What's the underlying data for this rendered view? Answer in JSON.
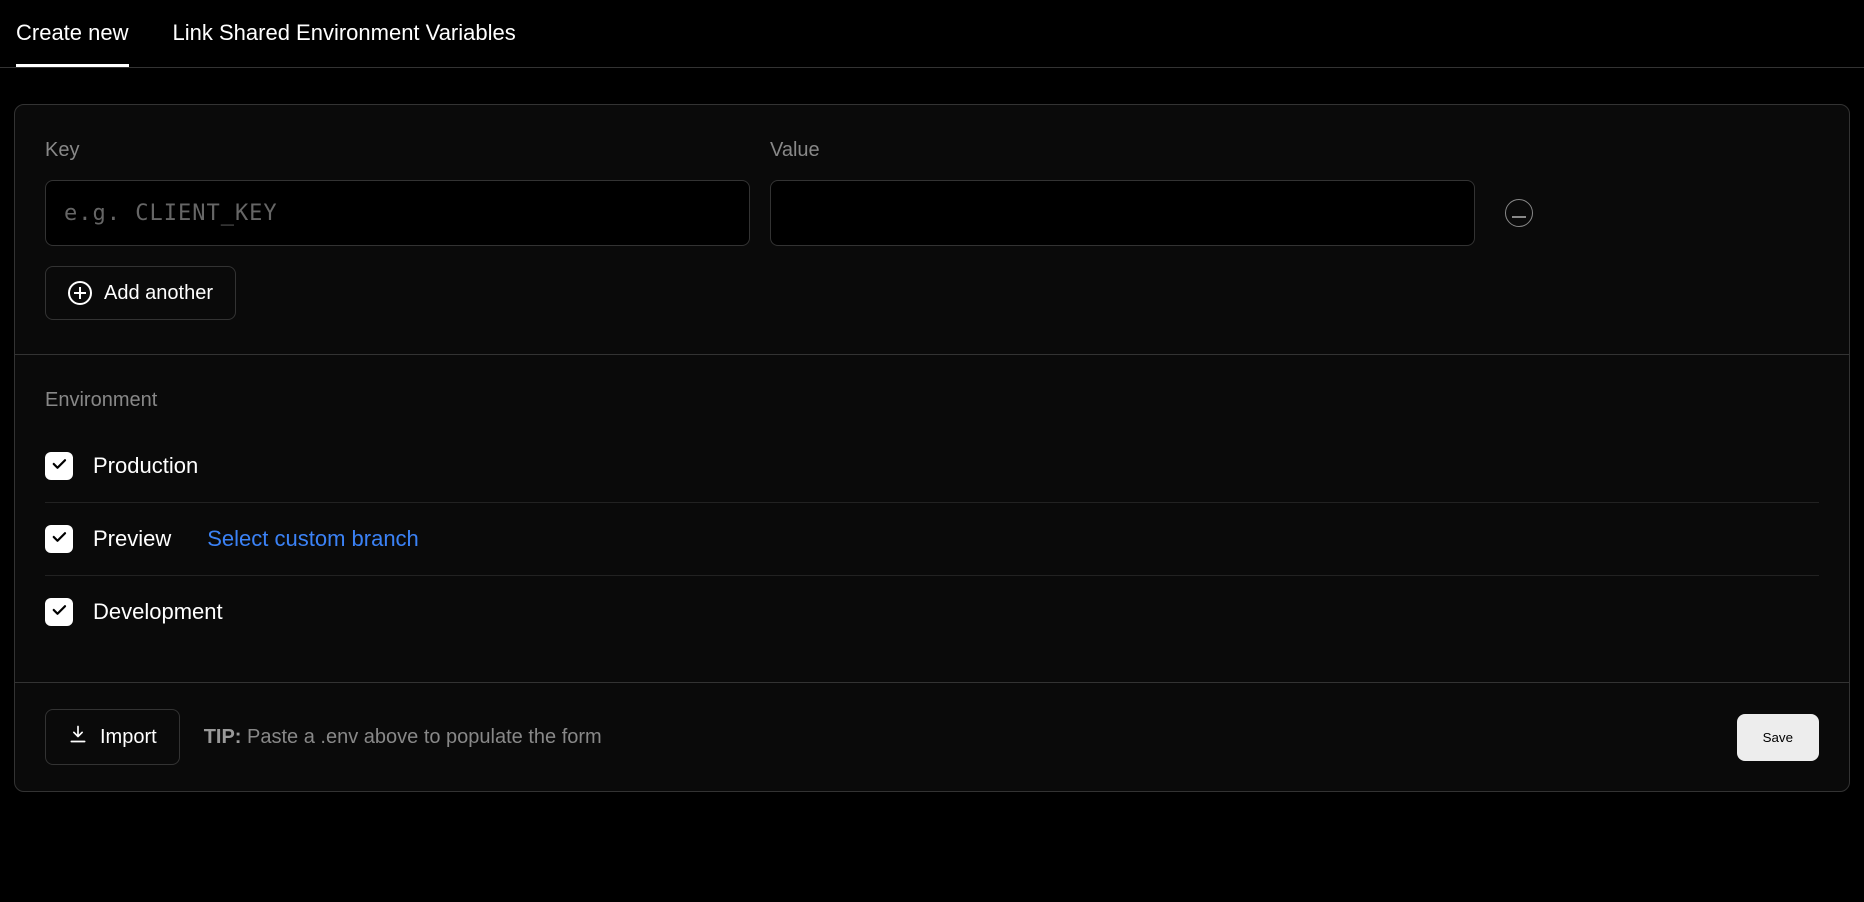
{
  "tabs": {
    "create": "Create new",
    "link": "Link Shared Environment Variables"
  },
  "form": {
    "key_label": "Key",
    "value_label": "Value",
    "key_placeholder": "e.g. CLIENT_KEY",
    "key_value": "",
    "value_value": "",
    "add_another": "Add another"
  },
  "environment": {
    "heading": "Environment",
    "items": [
      {
        "label": "Production",
        "checked": true
      },
      {
        "label": "Preview",
        "checked": true,
        "link": "Select custom branch"
      },
      {
        "label": "Development",
        "checked": true
      }
    ]
  },
  "footer": {
    "import": "Import",
    "tip_label": "TIP:",
    "tip_text": "Paste a .env above to populate the form",
    "save": "Save"
  }
}
